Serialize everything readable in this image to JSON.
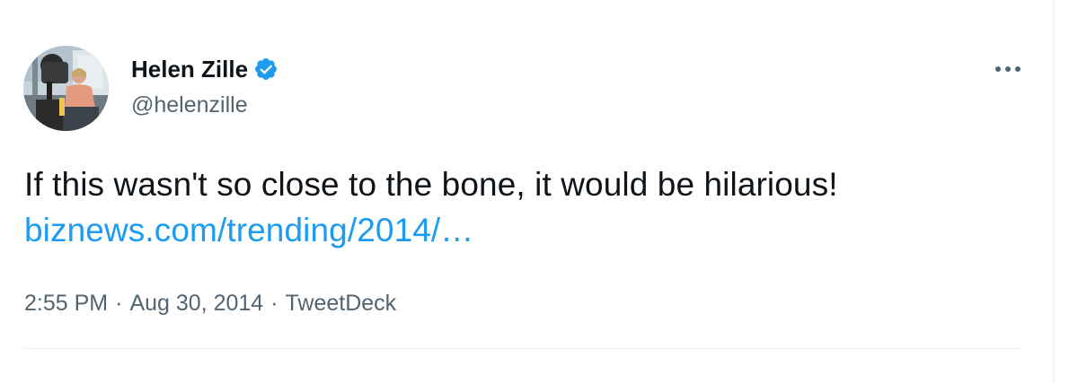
{
  "author": {
    "display_name": "Helen Zille",
    "handle": "@helenzille",
    "verified": true,
    "avatar_icon": "profile-photo"
  },
  "tweet": {
    "text": "If this wasn't so close to the bone, it would be hilarious! ",
    "link_text": "biznews.com/trending/2014/…"
  },
  "meta": {
    "time": "2:55 PM",
    "separator": "·",
    "date": "Aug 30, 2014",
    "source": "TweetDeck"
  },
  "icons": {
    "more": "more-options-icon",
    "verified": "verified-badge-icon"
  },
  "colors": {
    "link": "#1d9bf0",
    "verified": "#1d9bf0",
    "secondary_text": "#536471",
    "primary_text": "#0f1419"
  }
}
